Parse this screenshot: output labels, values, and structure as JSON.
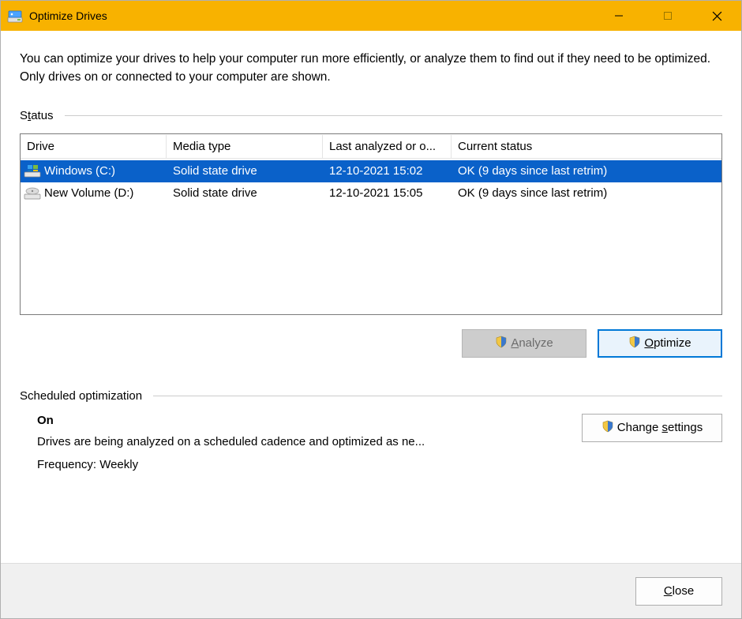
{
  "titlebar": {
    "title": "Optimize Drives"
  },
  "intro": "You can optimize your drives to help your computer run more efficiently, or analyze them to find out if they need to be optimized. Only drives on or connected to your computer are shown.",
  "status": {
    "section_label_pre": "S",
    "section_label_accesskey": "t",
    "section_label_post": "atus",
    "columns": {
      "drive": "Drive",
      "media": "Media type",
      "last": "Last analyzed or o...",
      "status": "Current status"
    },
    "rows": [
      {
        "drive": "Windows (C:)",
        "media": "Solid state drive",
        "last": "12-10-2021 15:02",
        "status": "OK (9 days since last retrim)",
        "selected": true,
        "icon": "windows-drive-icon"
      },
      {
        "drive": "New Volume (D:)",
        "media": "Solid state drive",
        "last": "12-10-2021 15:05",
        "status": "OK (9 days since last retrim)",
        "selected": false,
        "icon": "drive-icon"
      }
    ]
  },
  "buttons": {
    "analyze_accesskey": "A",
    "analyze_post": "nalyze",
    "optimize_accesskey": "O",
    "optimize_post": "ptimize",
    "change_pre": "Change ",
    "change_accesskey": "s",
    "change_post": "ettings",
    "close_accesskey": "C",
    "close_post": "lose"
  },
  "scheduled": {
    "section_label": "Scheduled optimization",
    "state": "On",
    "desc": "Drives are being analyzed on a scheduled cadence and optimized as ne...",
    "frequency": "Frequency: Weekly"
  }
}
